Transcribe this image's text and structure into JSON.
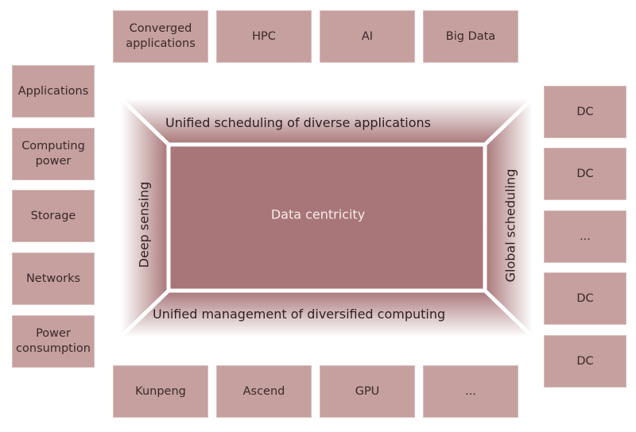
{
  "top_boxes": [
    {
      "label": "Converged\napplications"
    },
    {
      "label": "HPC"
    },
    {
      "label": "AI"
    },
    {
      "label": "Big Data"
    }
  ],
  "left_boxes": [
    {
      "label": "Applications"
    },
    {
      "label": "Computing\npower"
    },
    {
      "label": "Storage"
    },
    {
      "label": "Networks"
    },
    {
      "label": "Power\nconsumption"
    }
  ],
  "right_boxes": [
    {
      "label": "DC"
    },
    {
      "label": "DC"
    },
    {
      "label": "..."
    },
    {
      "label": "DC"
    },
    {
      "label": "DC"
    }
  ],
  "bottom_boxes": [
    {
      "label": "Kunpeng"
    },
    {
      "label": "Ascend"
    },
    {
      "label": "GPU"
    },
    {
      "label": "..."
    }
  ],
  "frame": {
    "top_label": "Unified scheduling of diverse applications",
    "bottom_label": "Unified management of diversified computing",
    "left_label": "Deep sensing",
    "right_label": "Global scheduling",
    "center_label": "Data centricity"
  },
  "colors": {
    "box_fill": "#c5a09f",
    "center_fill": "#a87678",
    "frame_dark": "#a87678",
    "text_dark": "#2e1f20"
  }
}
